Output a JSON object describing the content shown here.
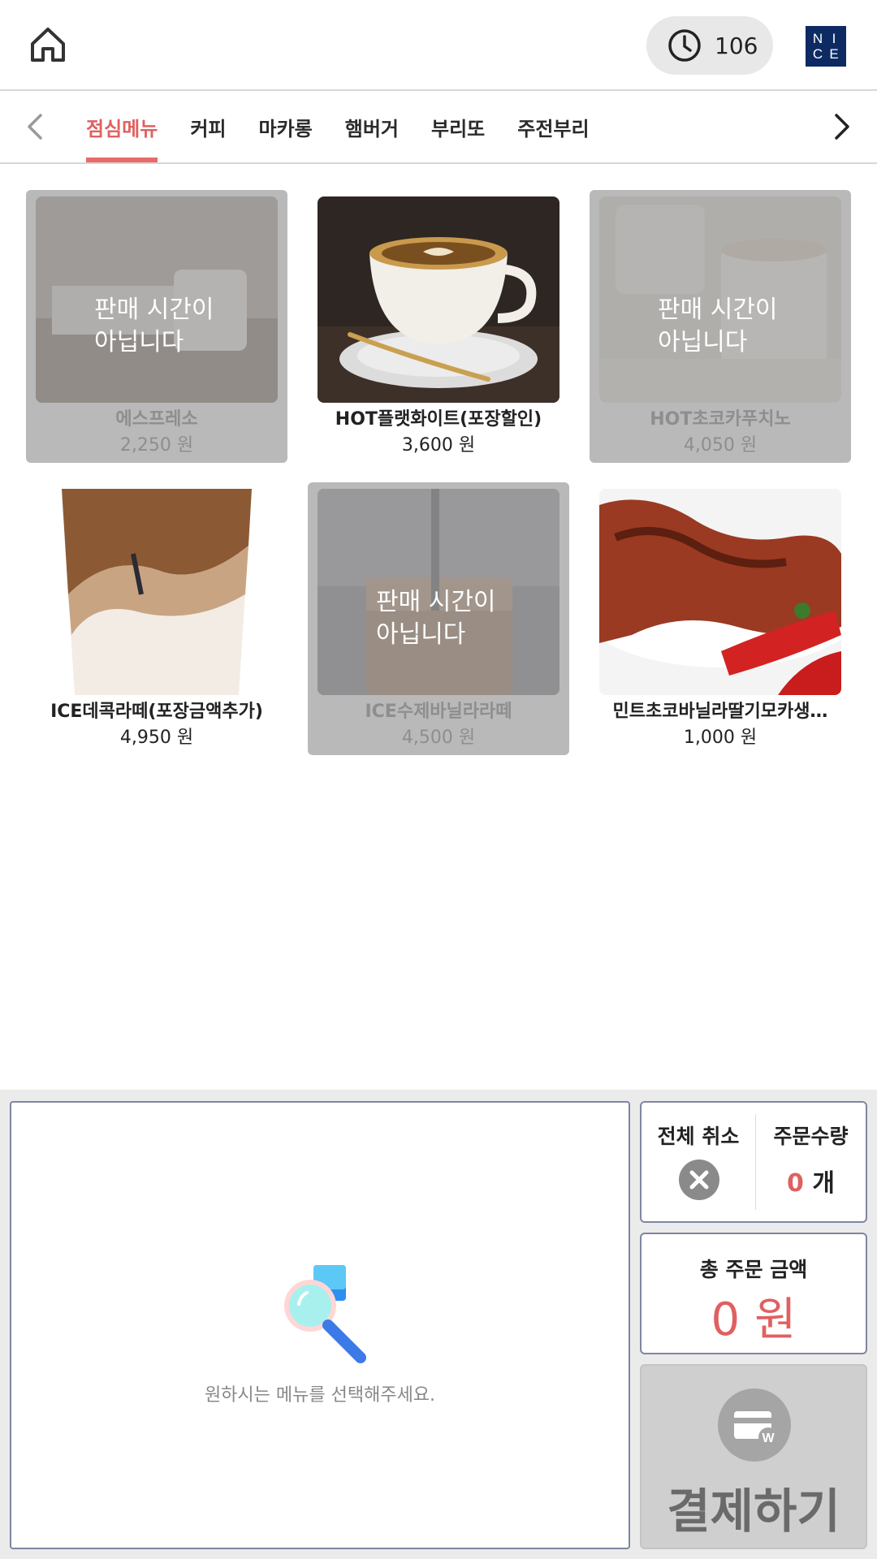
{
  "header": {
    "timer_value": "106",
    "brand_letters": [
      "N",
      "I",
      "C",
      "E"
    ]
  },
  "tabs": [
    {
      "label": "점심메뉴",
      "active": true
    },
    {
      "label": "커피",
      "active": false
    },
    {
      "label": "마카롱",
      "active": false
    },
    {
      "label": "햄버거",
      "active": false
    },
    {
      "label": "부리또",
      "active": false
    },
    {
      "label": "주전부리",
      "active": false
    }
  ],
  "menu": [
    {
      "name": "에스프레소",
      "price": "2,250 원",
      "unavailable": true,
      "overlay": [
        "판매 시간이",
        "아닙니다"
      ]
    },
    {
      "name": "HOT플랫화이트(포장할인)",
      "price": "3,600 원",
      "unavailable": false
    },
    {
      "name": "HOT초코카푸치노",
      "price": "4,050 원",
      "unavailable": true,
      "overlay": [
        "판매 시간이",
        "아닙니다"
      ]
    },
    {
      "name": "ICE데콕라떼(포장금액추가)",
      "price": "4,950 원",
      "unavailable": false
    },
    {
      "name": "ICE수제바닐라라떼",
      "price": "4,500 원",
      "unavailable": true,
      "overlay": [
        "판매 시간이",
        "아닙니다"
      ]
    },
    {
      "name": "민트초코바닐라딸기모카생…",
      "price": "1,000 원",
      "unavailable": false
    }
  ],
  "cart": {
    "empty_message": "원하시는 메뉴를 선택해주세요."
  },
  "summary": {
    "cancel_label": "전체 취소",
    "qty_label": "주문수량",
    "qty_value": "0",
    "qty_unit": " 개",
    "total_label": "총 주문 금액",
    "total_value": "0 원"
  },
  "pay": {
    "label": "결제하기"
  },
  "colors": {
    "accent": "#e06060",
    "brand": "#0d2a63"
  }
}
